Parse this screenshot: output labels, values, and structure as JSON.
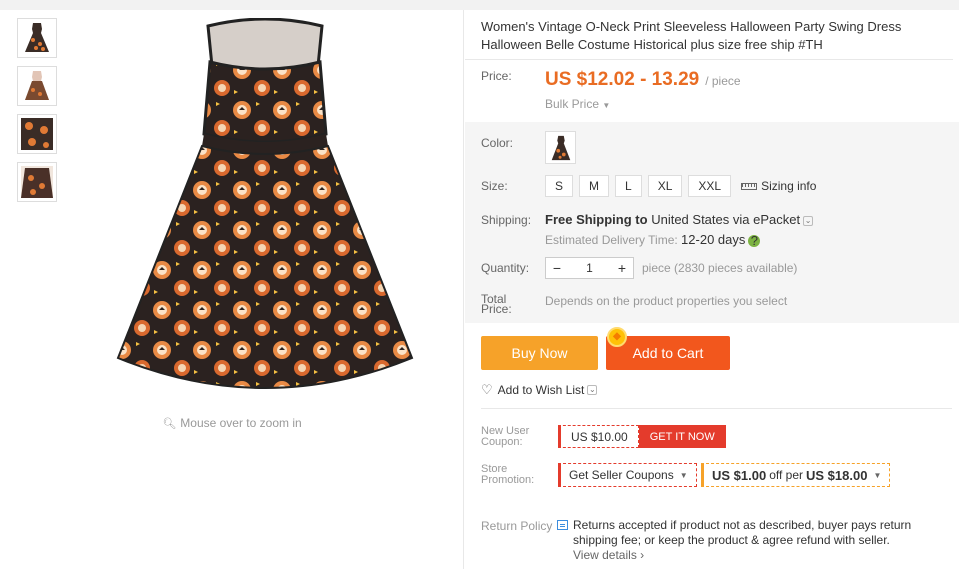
{
  "product": {
    "title": "Women's Vintage O-Neck Print Sleeveless Halloween Party Swing Dress Halloween Belle Costume Historical plus size free ship #TH",
    "zoom_hint": "Mouse over to zoom in"
  },
  "price": {
    "label": "Price:",
    "value": "US $12.02 - 13.29",
    "unit": "/ piece",
    "bulk": "Bulk Price"
  },
  "color": {
    "label": "Color:"
  },
  "size": {
    "label": "Size:",
    "options": [
      "S",
      "M",
      "L",
      "XL",
      "XXL"
    ],
    "sizing_info": "Sizing info"
  },
  "shipping": {
    "label": "Shipping:",
    "free": "Free Shipping",
    "to": "to",
    "country": "United States via ePacket",
    "eta_label": "Estimated Delivery Time:",
    "eta_value": "12-20 days"
  },
  "quantity": {
    "label": "Quantity:",
    "value": "1",
    "available": "piece (2830 pieces available)"
  },
  "total": {
    "label_line1": "Total",
    "label_line2": "Price:",
    "note": "Depends on the product properties you select"
  },
  "actions": {
    "buy_now": "Buy Now",
    "add_to_cart": "Add to Cart",
    "wish_list": "Add to Wish List"
  },
  "coupons": {
    "new_user_label_1": "New User",
    "new_user_label_2": "Coupon:",
    "new_user_amount": "US $10.00",
    "get_it_now": "GET IT NOW",
    "store_label_1": "Store",
    "store_label_2": "Promotion:",
    "seller_coupons": "Get Seller Coupons",
    "store_amount": "US $1.00",
    "store_off": "off per",
    "store_min": "US $18.00"
  },
  "return_policy": {
    "label": "Return Policy",
    "line1": "Returns accepted if product not as described, buyer pays return shipping fee; or keep the product & agree refund with seller.",
    "view": "View details ›"
  },
  "colors": {
    "price": "#e96c23",
    "buy_now": "#f6a229",
    "cart": "#f2571d",
    "coupon_red": "#e43b2c"
  }
}
